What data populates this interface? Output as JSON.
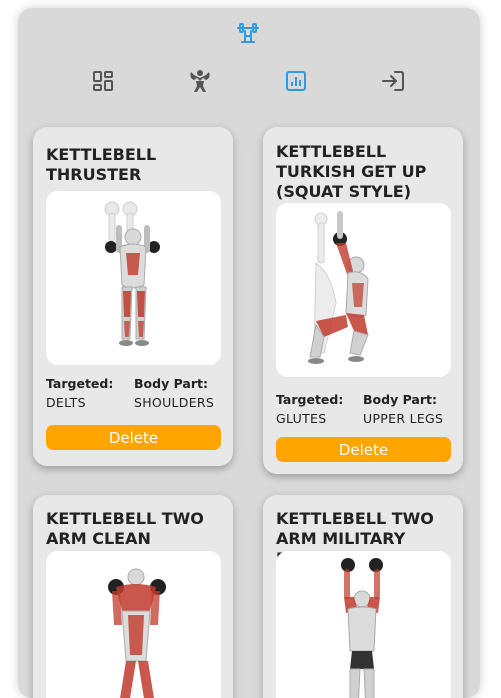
{
  "app": {
    "logo_icon": "barbell-icon"
  },
  "nav": [
    {
      "icon": "dashboard-icon",
      "active": false
    },
    {
      "icon": "muscle-icon",
      "active": false
    },
    {
      "icon": "stats-icon",
      "active": true
    },
    {
      "icon": "login-icon",
      "active": false
    }
  ],
  "colors": {
    "accent": "#2f9ae6",
    "delete": "#ffa500",
    "icon": "#555555",
    "panel": "#d9d9d9",
    "card": "#e8e8e8"
  },
  "labels": {
    "targeted": "Targeted:",
    "body_part": "Body Part:",
    "delete": "Delete"
  },
  "cards": [
    {
      "title": "KETTLEBELL THRUSTER",
      "targeted": "DELTS",
      "body_part": "SHOULDERS"
    },
    {
      "title": "KETTLEBELL TURKISH GET UP (SQUAT STYLE)",
      "targeted": "GLUTES",
      "body_part": "UPPER LEGS"
    },
    {
      "title": "KETTLEBELL TWO ARM CLEAN"
    },
    {
      "title": "KETTLEBELL TWO ARM MILITARY PRESS"
    }
  ]
}
